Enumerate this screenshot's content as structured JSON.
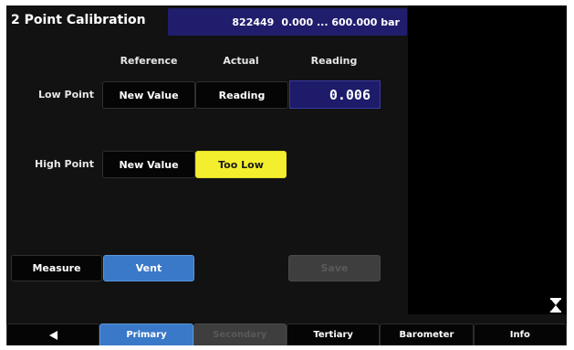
{
  "header": {
    "title": "2 Point Calibration",
    "serial": "822449",
    "range": "0.000 ... 600.000 bar"
  },
  "columns": {
    "reference": "Reference",
    "actual": "Actual",
    "reading": "Reading"
  },
  "low_point": {
    "label": "Low Point",
    "reference_button": "New Value",
    "actual_button": "Reading",
    "reading_value": "0.006"
  },
  "high_point": {
    "label": "High Point",
    "reference_button": "New Value",
    "actual_button": "Too Low"
  },
  "actions": {
    "measure": "Measure",
    "vent": "Vent",
    "save": "Save"
  },
  "tabs": {
    "back_icon": "back-arrow-icon",
    "primary": "Primary",
    "secondary": "Secondary",
    "tertiary": "Tertiary",
    "barometer": "Barometer",
    "info": "Info"
  },
  "icons": {
    "scroll": "hourglass-scroll-icon"
  },
  "colors": {
    "background": "#121212",
    "header_info_bg": "#201e6c",
    "accent_blue": "#3a78c8",
    "highlight_yellow": "#f3ef2f",
    "reading_bg": "#1d1b6a",
    "disabled_gray": "#3e3e3e"
  }
}
